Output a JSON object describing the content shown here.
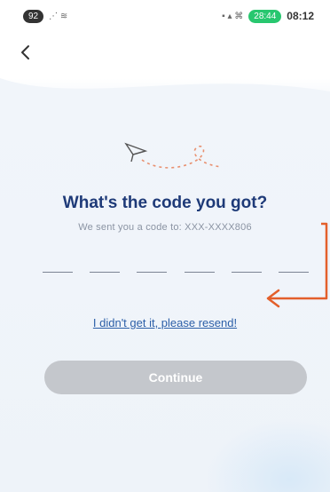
{
  "status_bar": {
    "left_badge": "92",
    "signal_text": "  % ≈",
    "speed_pill": "28:44",
    "time": "08:12"
  },
  "header": {
    "back_icon": "chevron-left-icon"
  },
  "main": {
    "title": "What's the code you got?",
    "subtitle": "We sent you a code to: XXX-XXXX806",
    "otp_slots": 6,
    "resend_label": "I didn't get it, please resend!",
    "continue_label": "Continue"
  },
  "colors": {
    "title": "#1e3a78",
    "link": "#2c5fa8",
    "button_disabled": "#c4c7cc",
    "annotation_arrow": "#e35f2b",
    "illustration_dash": "#e8906f"
  }
}
